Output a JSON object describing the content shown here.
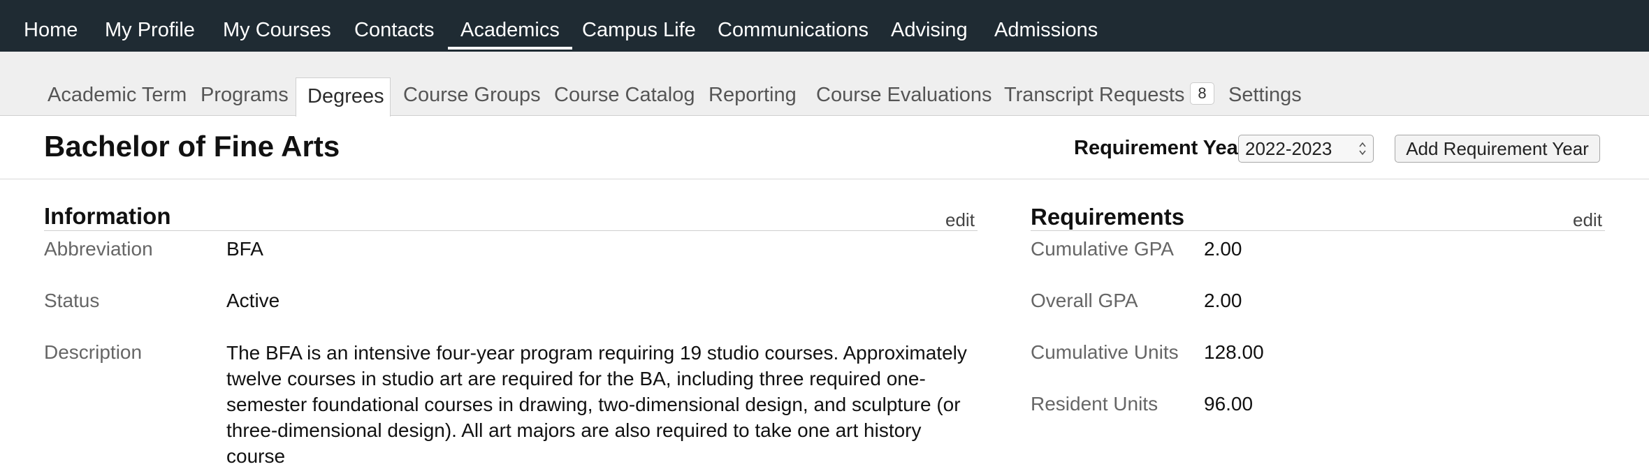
{
  "topnav": {
    "items": [
      {
        "label": "Home"
      },
      {
        "label": "My Profile"
      },
      {
        "label": "My Courses"
      },
      {
        "label": "Contacts"
      },
      {
        "label": "Academics",
        "active": true
      },
      {
        "label": "Campus Life"
      },
      {
        "label": "Communications"
      },
      {
        "label": "Advising"
      },
      {
        "label": "Admissions"
      }
    ]
  },
  "subnav": {
    "items": [
      {
        "label": "Academic Term"
      },
      {
        "label": "Programs"
      },
      {
        "label": "Degrees",
        "active": true
      },
      {
        "label": "Course Groups"
      },
      {
        "label": "Course Catalog"
      },
      {
        "label": "Reporting"
      },
      {
        "label": "Course Evaluations"
      },
      {
        "label": "Transcript Requests",
        "badge": "8"
      },
      {
        "label": "Settings"
      }
    ]
  },
  "header": {
    "title": "Bachelor of Fine Arts",
    "requirement_year_label": "Requirement Year",
    "requirement_year_value": "2022-2023",
    "add_requirement_year_label": "Add Requirement Year"
  },
  "information": {
    "title": "Information",
    "edit_label": "edit",
    "fields": [
      {
        "label": "Abbreviation",
        "value": "BFA"
      },
      {
        "label": "Status",
        "value": "Active"
      },
      {
        "label": "Description",
        "value": "The BFA is an intensive four-year program requiring 19 studio courses. Approximately twelve courses in studio art are required for the BA, including three required one-semester foundational courses in drawing, two-dimensional design, and sculpture (or three-dimensional design). All art majors are also required to take one art history course"
      }
    ]
  },
  "requirements": {
    "title": "Requirements",
    "edit_label": "edit",
    "fields": [
      {
        "label": "Cumulative GPA",
        "value": "2.00"
      },
      {
        "label": "Overall GPA",
        "value": "2.00"
      },
      {
        "label": "Cumulative Units",
        "value": "128.00"
      },
      {
        "label": "Resident Units",
        "value": "96.00"
      }
    ]
  },
  "colors": {
    "topnav_background": "#1f2b33",
    "subnav_background": "#efefef"
  }
}
